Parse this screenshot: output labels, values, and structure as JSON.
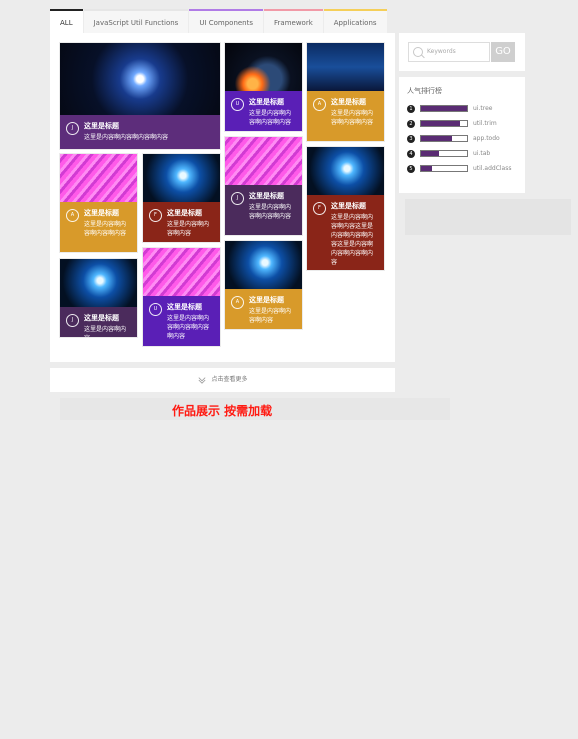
{
  "tabs": [
    {
      "label": "ALL"
    },
    {
      "label": "JavaScript Util Functions"
    },
    {
      "label": "UI Components"
    },
    {
      "label": "Framework"
    },
    {
      "label": "Applications"
    }
  ],
  "cards": [
    {
      "badge": "J",
      "title": "这里是标题",
      "desc": "这里是内容啊内容啊内容啊内容"
    },
    {
      "badge": "U",
      "title": "这里是标题",
      "desc": "这里是内容啊内容啊内容啊内容"
    },
    {
      "badge": "A",
      "title": "这里是标题",
      "desc": "这里是内容啊内容啊内容啊内容"
    },
    {
      "badge": "A",
      "title": "这里是标题",
      "desc": "这里是内容啊内容啊内容啊内容"
    },
    {
      "badge": "F",
      "title": "这里是标题",
      "desc": "这里是内容啊内容啊内容"
    },
    {
      "badge": "J",
      "title": "这里是标题",
      "desc": "这里是内容啊内容啊内容啊内容"
    },
    {
      "badge": "F",
      "title": "这里是标题",
      "desc": "这里是内容啊内容啊内容这里是内容啊内容啊内容这里是内容啊内容啊内容啊内容"
    },
    {
      "badge": "J",
      "title": "这里是标题",
      "desc": "这里是内容啊内容"
    },
    {
      "badge": "U",
      "title": "这里是标题",
      "desc": "这里是内容啊内容啊内容啊内容啊内容"
    },
    {
      "badge": "A",
      "title": "这里是标题",
      "desc": "这里是内容啊内容啊内容"
    }
  ],
  "search": {
    "placeholder": "Keywords",
    "button": "GO"
  },
  "ranking": {
    "title": "人气排行榜",
    "items": [
      {
        "num": "1",
        "label": "ui.tree",
        "value": 1.0
      },
      {
        "num": "2",
        "label": "util.trim",
        "value": 0.85
      },
      {
        "num": "3",
        "label": "app.todo",
        "value": 0.68
      },
      {
        "num": "4",
        "label": "ui.tab",
        "value": 0.4
      },
      {
        "num": "5",
        "label": "util.addClass",
        "value": 0.24
      }
    ]
  },
  "load_more": {
    "label": "点击查看更多"
  },
  "caption": "作品展示 按需加载"
}
